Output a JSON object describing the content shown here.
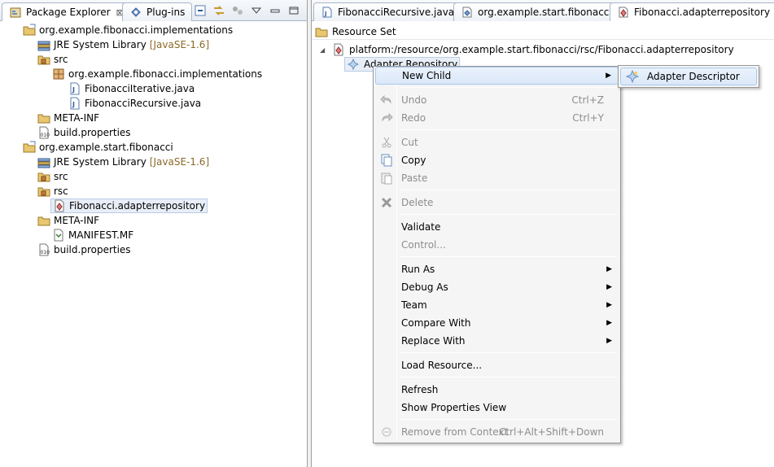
{
  "left": {
    "tabs": [
      {
        "label": "Package Explorer",
        "close": "⊠"
      },
      {
        "label": "Plug-ins"
      }
    ],
    "tree": [
      {
        "label": "org.example.fibonacci.implementations",
        "icon": "project-icon"
      },
      {
        "label": "JRE System Library",
        "dec": "[JavaSE-1.6]",
        "icon": "library-icon"
      },
      {
        "label": "src",
        "icon": "source-folder-icon"
      },
      {
        "label": "org.example.fibonacci.implementations",
        "icon": "package-icon"
      },
      {
        "label": "FibonacciIterative.java",
        "icon": "java-file-icon"
      },
      {
        "label": "FibonacciRecursive.java",
        "icon": "java-file-icon"
      },
      {
        "label": "META-INF",
        "icon": "folder-icon"
      },
      {
        "label": "build.properties",
        "icon": "properties-file-icon"
      },
      {
        "label": "org.example.start.fibonacci",
        "icon": "project-icon"
      },
      {
        "label": "JRE System Library",
        "dec": "[JavaSE-1.6]",
        "icon": "library-icon"
      },
      {
        "label": "src",
        "icon": "source-folder-icon"
      },
      {
        "label": "rsc",
        "icon": "source-folder-icon"
      },
      {
        "label": "Fibonacci.adapterrepository",
        "icon": "repository-file-icon"
      },
      {
        "label": "META-INF",
        "icon": "folder-icon"
      },
      {
        "label": "MANIFEST.MF",
        "icon": "manifest-file-icon"
      },
      {
        "label": "build.properties",
        "icon": "properties-file-icon"
      }
    ]
  },
  "right": {
    "tabs": [
      {
        "label": "FibonacciRecursive.java"
      },
      {
        "label": "org.example.start.fibonacci"
      },
      {
        "label": "Fibonacci.adapterrepository"
      }
    ],
    "resource_set": "Resource Set",
    "platform_uri": "platform:/resource/org.example.start.fibonacci/rsc/Fibonacci.adapterrepository",
    "adapter_repository": "Adapter Repository"
  },
  "menu": {
    "items": [
      {
        "label": "New Child",
        "submenu": true
      },
      {
        "label": "Undo",
        "acc": "Ctrl+Z",
        "disabled": true
      },
      {
        "label": "Redo",
        "acc": "Ctrl+Y",
        "disabled": true
      },
      {
        "label": "Cut",
        "disabled": true
      },
      {
        "label": "Copy"
      },
      {
        "label": "Paste",
        "disabled": true
      },
      {
        "label": "Delete",
        "disabled": true
      },
      {
        "label": "Validate"
      },
      {
        "label": "Control...",
        "disabled": true
      },
      {
        "label": "Run As",
        "submenu": true
      },
      {
        "label": "Debug As",
        "submenu": true
      },
      {
        "label": "Team",
        "submenu": true
      },
      {
        "label": "Compare With",
        "submenu": true
      },
      {
        "label": "Replace With",
        "submenu": true
      },
      {
        "label": "Load Resource..."
      },
      {
        "label": "Refresh"
      },
      {
        "label": "Show Properties View"
      },
      {
        "label": "Remove from Context",
        "acc": "Ctrl+Alt+Shift+Down",
        "disabled": true
      }
    ],
    "submenu_item": "Adapter Descriptor",
    "arrow": "▶"
  }
}
